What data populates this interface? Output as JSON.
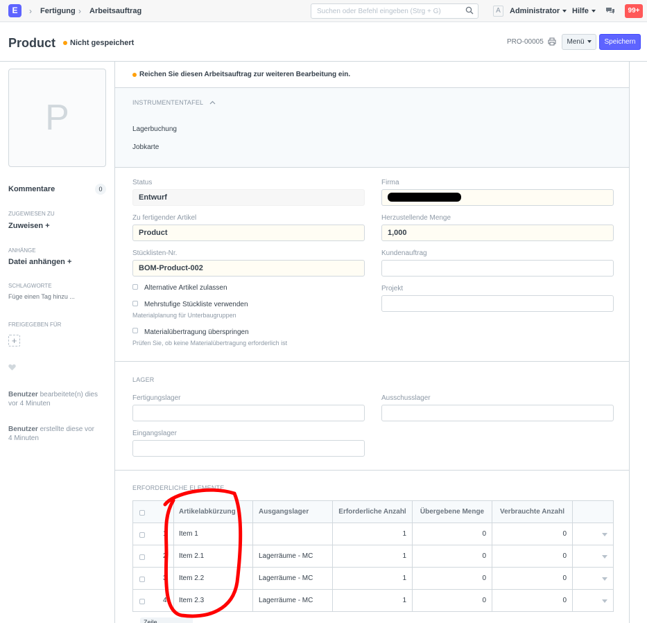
{
  "navbar": {
    "logo": "E",
    "breadcrumbs": [
      "Fertigung",
      "Arbeitsauftrag"
    ],
    "search_placeholder": "Suchen oder Befehl eingeben (Strg + G)",
    "avatar_letter": "A",
    "user": "Administrator",
    "help": "Hilfe",
    "notifications": "99+"
  },
  "page": {
    "title": "Product",
    "status": "Nicht gespeichert",
    "doc_name": "PRO-00005",
    "menu_label": "Menü",
    "save_label": "Speichern"
  },
  "sidebar": {
    "image_letter": "P",
    "comments_label": "Kommentare",
    "comments_count": "0",
    "assigned_label": "ZUGEWIESEN ZU",
    "assign_action": "Zuweisen",
    "attachments_label": "ANHÄNGE",
    "attach_action": "Datei anhängen",
    "tags_label": "SCHLAGWORTE",
    "tags_placeholder": "Füge einen Tag hinzu ...",
    "shared_label": "FREIGEGEBEN FÜR",
    "timeline": [
      {
        "user": "Benutzer",
        "text": "bearbeitete(n) dies vor 4 Minuten"
      },
      {
        "user": "Benutzer",
        "text": "erstellte diese vor 4 Minuten"
      }
    ]
  },
  "alert": "Reichen Sie diesen Arbeitsauftrag zur weiteren Bearbeitung ein.",
  "dashboard": {
    "title": "INSTRUMENTENTAFEL",
    "links": [
      "Lagerbuchung",
      "Jobkarte"
    ]
  },
  "form": {
    "status_label": "Status",
    "status_value": "Entwurf",
    "company_label": "Firma",
    "company_value": "",
    "item_label": "Zu fertigender Artikel",
    "item_value": "Product",
    "qty_label": "Herzustellende Menge",
    "qty_value": "1,000",
    "bom_label": "Stücklisten-Nr.",
    "bom_value": "BOM-Product-002",
    "sales_order_label": "Kundenauftrag",
    "project_label": "Projekt",
    "alt_items_label": "Alternative Artikel zulassen",
    "multilevel_label": "Mehrstufige Stückliste verwenden",
    "multilevel_help": "Materialplanung für Unterbaugruppen",
    "skip_transfer_label": "Materialübertragung überspringen",
    "skip_transfer_help": "Prüfen Sie, ob keine Materialübertragung erforderlich ist"
  },
  "warehouse": {
    "title": "LAGER",
    "wip_label": "Fertigungslager",
    "scrap_label": "Ausschusslager",
    "source_label": "Eingangslager"
  },
  "required_items": {
    "title": "ERFORDERLICHE ELEMENTE",
    "columns": [
      "Artikelabkürzung",
      "Ausgangslager",
      "Erforderliche Anzahl",
      "Übergebene Menge",
      "Verbrauchte Anzahl"
    ],
    "rows": [
      {
        "idx": "1",
        "item": "Item 1",
        "warehouse": "",
        "required": "1",
        "transferred": "0",
        "consumed": "0"
      },
      {
        "idx": "2",
        "item": "Item 2.1",
        "warehouse": "Lagerräume - MC",
        "required": "1",
        "transferred": "0",
        "consumed": "0"
      },
      {
        "idx": "3",
        "item": "Item 2.2",
        "warehouse": "Lagerräume - MC",
        "required": "1",
        "transferred": "0",
        "consumed": "0"
      },
      {
        "idx": "4",
        "item": "Item 2.3",
        "warehouse": "Lagerräume - MC",
        "required": "1",
        "transferred": "0",
        "consumed": "0"
      }
    ],
    "add_row": "Zeile hinzufügen"
  },
  "colors": {
    "primary": "#5e64ff",
    "indicator_orange": "#ffa00a",
    "notification_red": "#ff5858",
    "annotation_red": "#ff0000"
  }
}
